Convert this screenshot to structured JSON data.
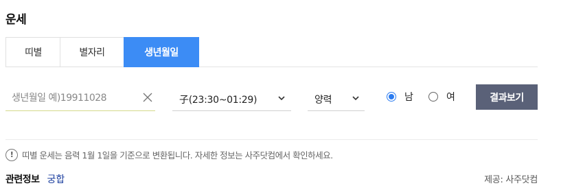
{
  "header": {
    "title": "운세"
  },
  "tabs": [
    {
      "label": "띠별"
    },
    {
      "label": "별자리"
    },
    {
      "label": "생년월일"
    }
  ],
  "form": {
    "birth_input": {
      "placeholder": "생년월일 예)19911028",
      "value": ""
    },
    "time_select": {
      "selected": "子(23:30~01:29)"
    },
    "calendar_select": {
      "selected": "양력"
    },
    "gender": {
      "options": [
        {
          "label": "남",
          "checked": true
        },
        {
          "label": "여",
          "checked": false
        }
      ]
    },
    "submit_label": "결과보기"
  },
  "notice": {
    "text": "띠별 운세는 음력 1월 1일을 기준으로 변환됩니다. 자세한 정보는 사주닷컴에서 확인하세요."
  },
  "footer": {
    "related_label": "관련정보",
    "related_link": "궁합",
    "provider": "제공: 사주닷컴"
  },
  "colors": {
    "accent": "#3c8cf5",
    "button": "#5a6178",
    "link": "#1a3d9e",
    "radio": "#2a7bf0"
  },
  "icons": {
    "clear": "close-icon",
    "dropdown": "chevron-down-icon",
    "info": "exclamation-icon"
  }
}
